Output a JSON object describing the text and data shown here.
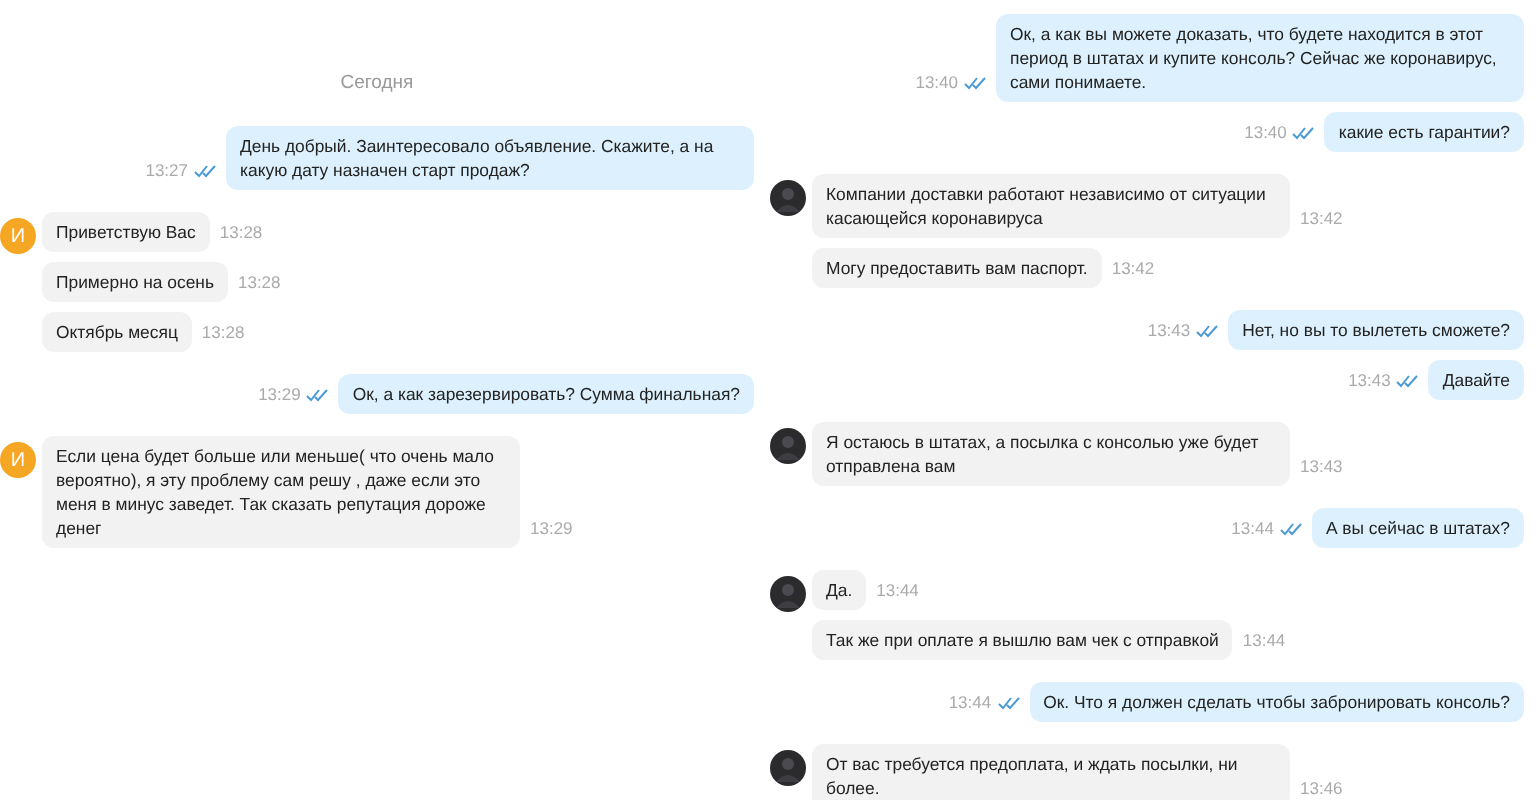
{
  "panes": [
    {
      "date_label": "Сегодня",
      "groups": [
        {
          "kind": "out",
          "messages": [
            {
              "text": "День добрый. Заинтересовало объявление. Скажите, а на какую дату назначен старт продаж?",
              "time": "13:27",
              "read": true
            }
          ]
        },
        {
          "kind": "in",
          "avatar": {
            "kind": "letter",
            "letter": "И",
            "color": "#f5a623"
          },
          "messages": [
            {
              "text": "Приветствую Вас",
              "time": "13:28"
            },
            {
              "text": "Примерно на осень",
              "time": "13:28"
            },
            {
              "text": "Октябрь месяц",
              "time": "13:28"
            }
          ]
        },
        {
          "kind": "out",
          "messages": [
            {
              "text": "Ок, а как зарезервировать? Сумма финальная?",
              "time": "13:29",
              "read": true
            }
          ]
        },
        {
          "kind": "in",
          "avatar": {
            "kind": "letter",
            "letter": "И",
            "color": "#f5a623"
          },
          "messages": [
            {
              "text": "Если цена будет больше или меньше( что очень мало вероятно), я эту проблему сам решу , даже если это меня в минус заведет. Так сказать репутация дороже денег",
              "time": "13:29"
            }
          ]
        }
      ]
    },
    {
      "groups": [
        {
          "kind": "out",
          "messages": [
            {
              "text": "Ок, а как вы можете доказать, что будете находится в этот период в штатах и купите консоль? Сейчас же коронавирус, сами понимаете.",
              "time": "13:40",
              "read": true
            },
            {
              "text": "какие есть гарантии?",
              "time": "13:40",
              "read": true
            }
          ]
        },
        {
          "kind": "in",
          "avatar": {
            "kind": "photo"
          },
          "messages": [
            {
              "text": "Компании доставки работают независимо от ситуации касающейся коронавируса",
              "time": "13:42"
            },
            {
              "text": "Могу предоставить вам паспорт.",
              "time": "13:42"
            }
          ]
        },
        {
          "kind": "out",
          "messages": [
            {
              "text": "Нет, но вы то вылететь сможете?",
              "time": "13:43",
              "read": true
            },
            {
              "text": "Давайте",
              "time": "13:43",
              "read": true
            }
          ]
        },
        {
          "kind": "in",
          "avatar": {
            "kind": "photo"
          },
          "messages": [
            {
              "text": "Я остаюсь в штатах, а посылка с консолью уже будет отправлена вам",
              "time": "13:43"
            }
          ]
        },
        {
          "kind": "out",
          "messages": [
            {
              "text": "А вы сейчас в штатах?",
              "time": "13:44",
              "read": true
            }
          ]
        },
        {
          "kind": "in",
          "avatar": {
            "kind": "photo"
          },
          "messages": [
            {
              "text": "Да.",
              "time": "13:44"
            },
            {
              "text": "Так же при оплате я вышлю вам чек с отправкой",
              "time": "13:44"
            }
          ]
        },
        {
          "kind": "out",
          "messages": [
            {
              "text": "Ок. Что я должен сделать чтобы забронировать консоль?",
              "time": "13:44",
              "read": true
            }
          ]
        },
        {
          "kind": "in",
          "avatar": {
            "kind": "photo"
          },
          "messages": [
            {
              "text": "От вас требуется предоплата, и ждать посылки, ни более.",
              "time": "13:46"
            }
          ]
        }
      ]
    }
  ]
}
